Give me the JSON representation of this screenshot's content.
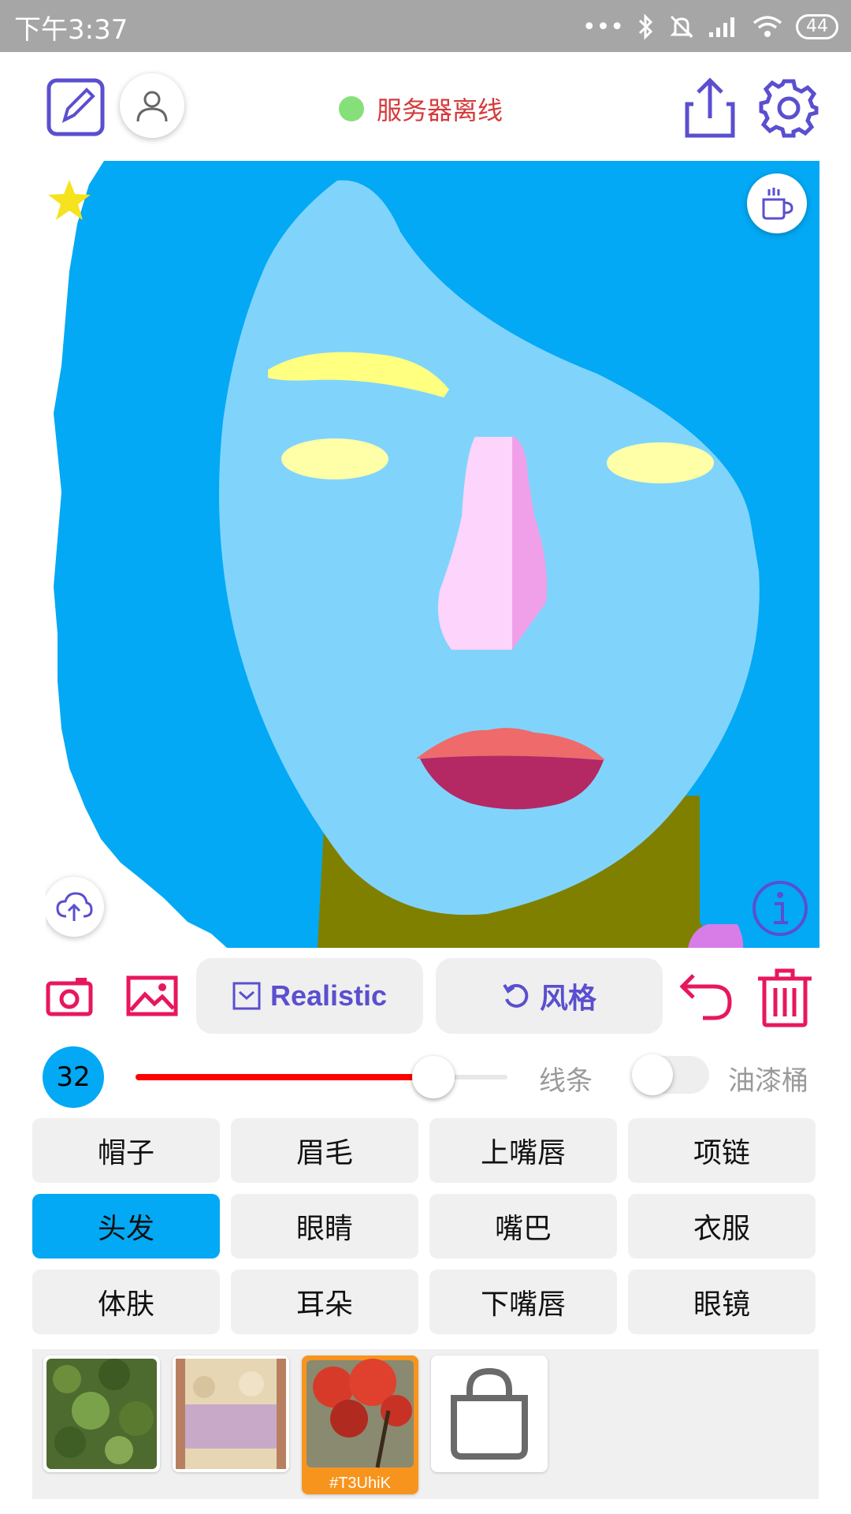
{
  "status_bar": {
    "time": "下午3:37",
    "battery": "44"
  },
  "header": {
    "server_status": "服务器离线"
  },
  "toolbar": {
    "model_label": "Realistic",
    "style_label": "风格"
  },
  "brush": {
    "size": "32",
    "level": 0.8,
    "mode_label": "线条",
    "fill_label": "油漆桶"
  },
  "categories": [
    [
      "帽子",
      "眉毛",
      "上嘴唇",
      "项链"
    ],
    [
      "头发",
      "眼睛",
      "嘴巴",
      "衣服"
    ],
    [
      "体肤",
      "耳朵",
      "下嘴唇",
      "眼镜"
    ]
  ],
  "active_category": "头发",
  "styles": {
    "active_code": "#T3UhiK"
  },
  "colors": {
    "accent": "#5a4fcf",
    "active_category": "#03a9f4",
    "danger": "#e8175d",
    "slider": "#ff0000"
  }
}
